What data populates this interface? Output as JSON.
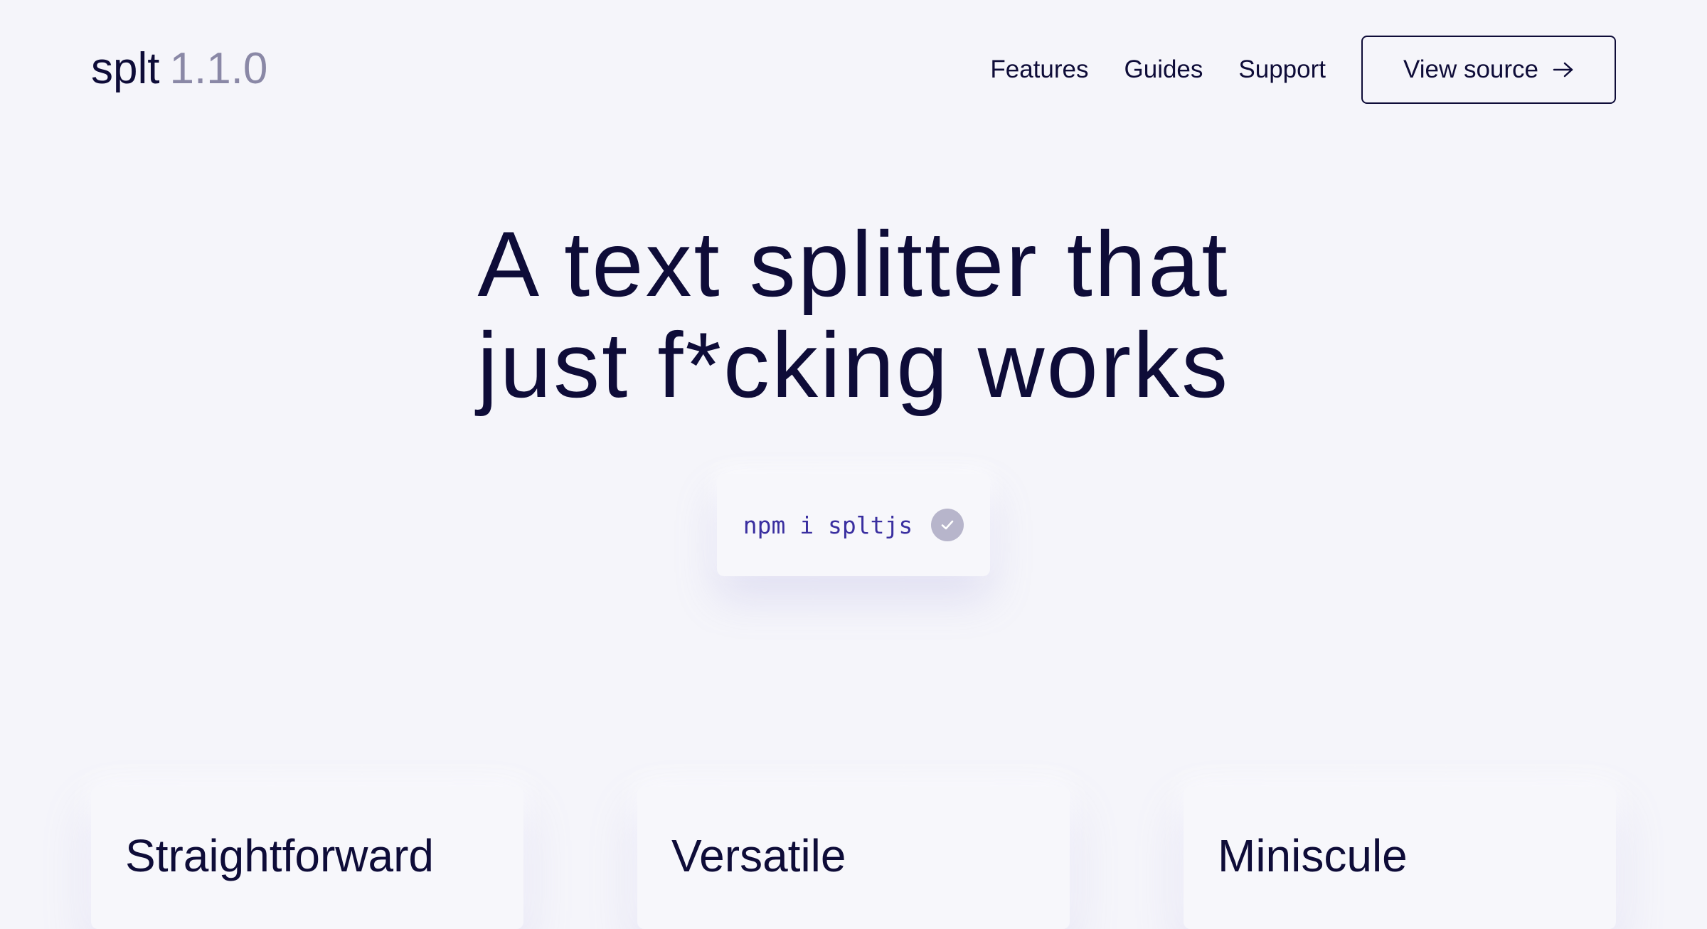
{
  "header": {
    "logo_name": "splt",
    "logo_version": "1.1.0",
    "nav": [
      {
        "label": "Features"
      },
      {
        "label": "Guides"
      },
      {
        "label": "Support"
      }
    ],
    "cta_label": "View source",
    "cta_icon": "arrow-right-icon"
  },
  "hero": {
    "title_line1": "A text splitter that",
    "title_line2": "just f*cking works",
    "install_command": "npm i spltjs",
    "install_icon": "check-icon"
  },
  "features": [
    {
      "title": "Straightforward"
    },
    {
      "title": "Versatile"
    },
    {
      "title": "Miniscule"
    }
  ],
  "colors": {
    "background": "#f5f5fa",
    "text": "#0e0c38",
    "muted": "#8a88a6",
    "code": "#3a2fa0",
    "check": "#b7b5cb"
  }
}
